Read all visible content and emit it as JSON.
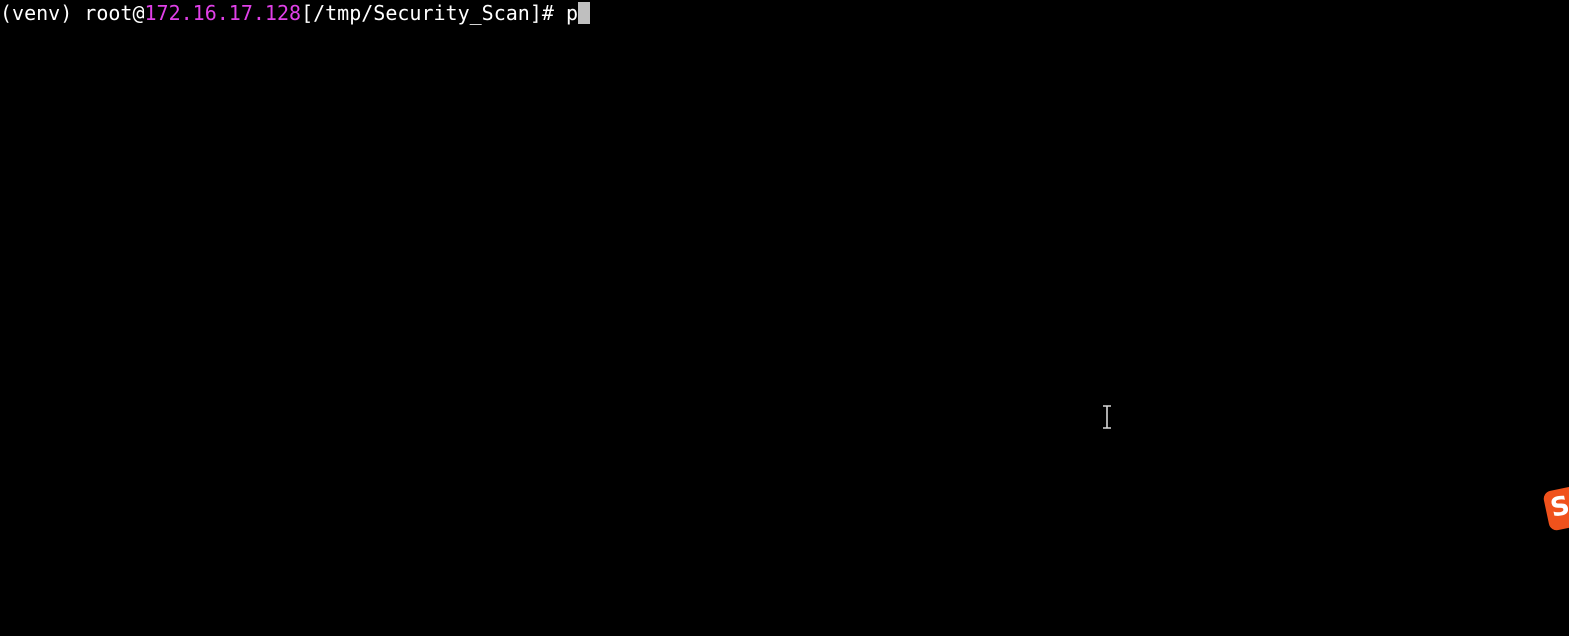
{
  "terminal": {
    "prompt": {
      "venv": "(venv) ",
      "user": "root@",
      "host": "172.16.17.128",
      "path": "[/tmp/Security_Scan]# "
    },
    "input": "p"
  },
  "ime_badge": {
    "letter": "S",
    "icon": "ime-s-icon",
    "color": "#f0521c"
  },
  "colors": {
    "background": "#000000",
    "text": "#ffffff",
    "host": "#e040e8",
    "cursor": "#bfbfbf"
  }
}
